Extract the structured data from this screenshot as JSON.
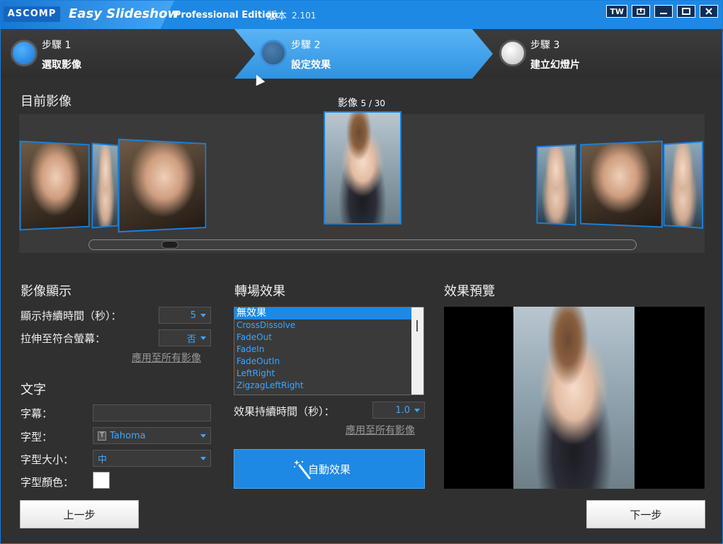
{
  "titlebar": {
    "logo": "ASCOMP",
    "app_name": "Easy Slideshow",
    "edition": "Professional Edition",
    "version_label": "版本",
    "version_number": "2.101",
    "language_button": "TW"
  },
  "steps": [
    {
      "num": "步驟 1",
      "name": "選取影像",
      "state": "done"
    },
    {
      "num": "步驟 2",
      "name": "設定效果",
      "state": "active"
    },
    {
      "num": "步驟 3",
      "name": "建立幻燈片",
      "state": "pending"
    }
  ],
  "current_image": {
    "title": "目前影像",
    "counter_label": "影像",
    "counter_value": "5 / 30",
    "current_index": 5,
    "total": 30
  },
  "image_display": {
    "title": "影像顯示",
    "duration_label": "顯示持續時間（秒）：",
    "duration_value": "5",
    "stretch_label": "拉伸至符合螢幕：",
    "stretch_value": "否",
    "apply_all": "應用至所有影像"
  },
  "text": {
    "title": "文字",
    "caption_label": "字幕：",
    "caption_value": "",
    "font_label": "字型：",
    "font_value": "Tahoma",
    "size_label": "字型大小：",
    "size_value": "中",
    "color_label": "字型顏色：",
    "color_value": "#ffffff"
  },
  "transition": {
    "title": "轉場效果",
    "items": [
      "無效果",
      "CrossDissolve",
      "FadeOut",
      "FadeIn",
      "FadeOutIn",
      "LeftRight",
      "ZigzagLeftRight"
    ],
    "selected": "無效果",
    "duration_label": "效果持續時間（秒）：",
    "duration_value": "1.0",
    "apply_all": "應用至所有影像",
    "auto_button": "自動效果"
  },
  "preview": {
    "title": "效果預覽"
  },
  "nav": {
    "prev": "上一步",
    "next": "下一步"
  },
  "colors": {
    "accent": "#1e88e5",
    "link_blue": "#3da6ff",
    "background": "#303030"
  }
}
